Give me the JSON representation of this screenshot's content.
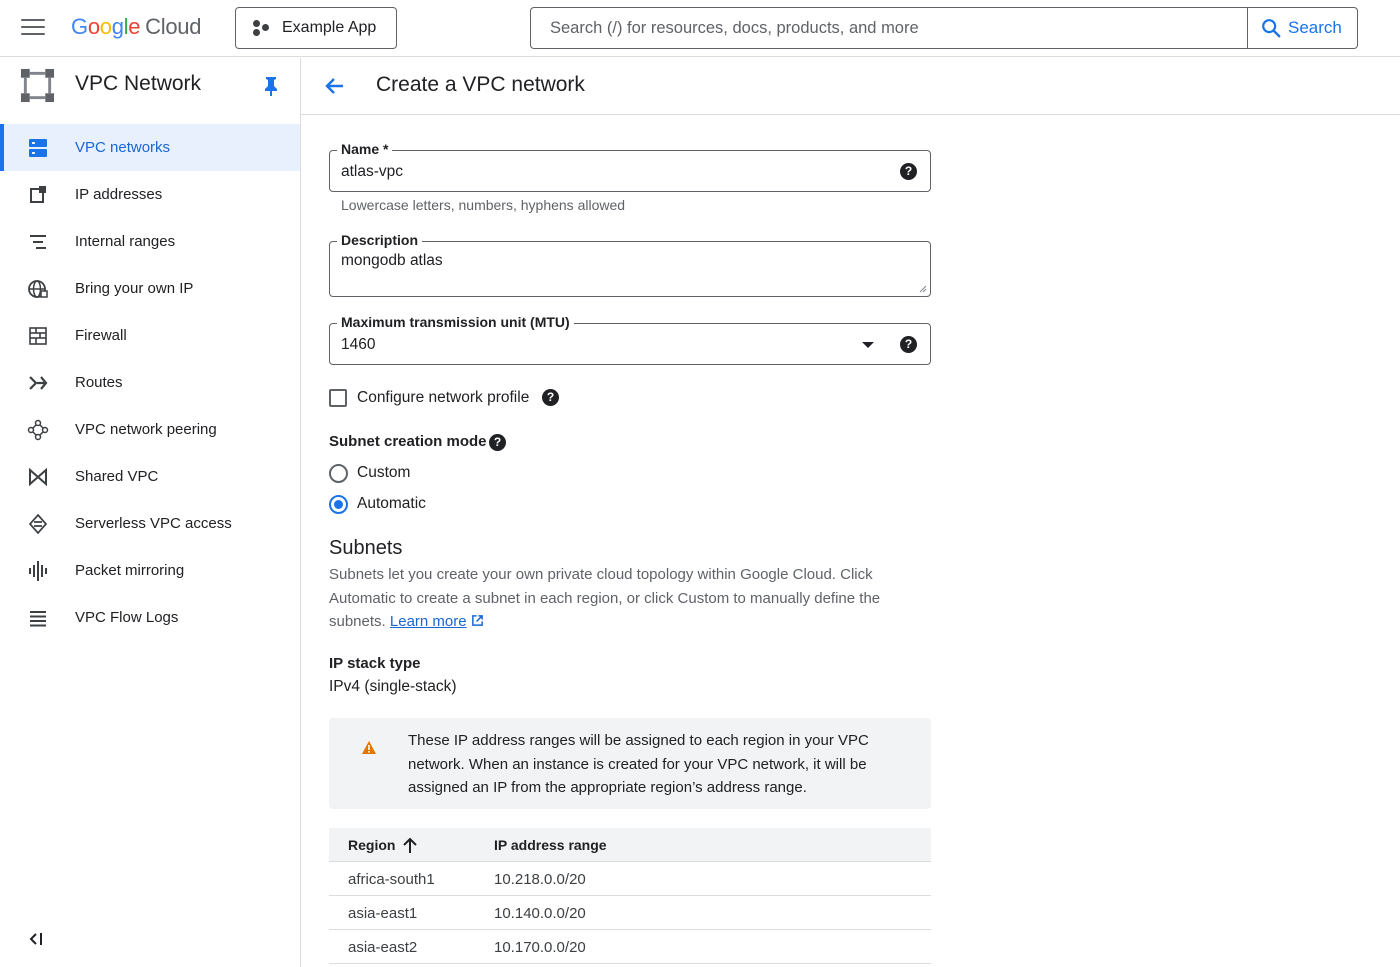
{
  "topbar": {
    "logo_letters": [
      "G",
      "o",
      "o",
      "g",
      "l",
      "e"
    ],
    "logo_product": "Cloud",
    "project_name": "Example App",
    "search_placeholder": "Search (/) for resources, docs, products, and more",
    "search_button": "Search"
  },
  "sidebar": {
    "title": "VPC Network",
    "items": [
      {
        "label": "VPC networks",
        "icon": "vpc-networks-icon",
        "active": true
      },
      {
        "label": "IP addresses",
        "icon": "ip-addresses-icon"
      },
      {
        "label": "Internal ranges",
        "icon": "internal-ranges-icon"
      },
      {
        "label": "Bring your own IP",
        "icon": "globe-icon"
      },
      {
        "label": "Firewall",
        "icon": "firewall-icon"
      },
      {
        "label": "Routes",
        "icon": "routes-icon"
      },
      {
        "label": "VPC network peering",
        "icon": "peering-icon"
      },
      {
        "label": "Shared VPC",
        "icon": "shared-vpc-icon"
      },
      {
        "label": "Serverless VPC access",
        "icon": "serverless-icon"
      },
      {
        "label": "Packet mirroring",
        "icon": "packet-mirroring-icon"
      },
      {
        "label": "VPC Flow Logs",
        "icon": "flow-logs-icon"
      }
    ]
  },
  "page": {
    "title": "Create a VPC network"
  },
  "form": {
    "name_label": "Name *",
    "name_value": "atlas-vpc",
    "name_hint": "Lowercase letters, numbers, hyphens allowed",
    "description_label": "Description",
    "description_value": "mongodb atlas",
    "mtu_label": "Maximum transmission unit (MTU)",
    "mtu_value": "1460",
    "network_profile_label": "Configure network profile",
    "subnet_mode_label": "Subnet creation mode",
    "subnet_mode_options": [
      "Custom",
      "Automatic"
    ],
    "subnet_mode_selected": "Automatic",
    "help_glyph": "?"
  },
  "subnets": {
    "title": "Subnets",
    "description": "Subnets let you create your own private cloud topology within Google Cloud. Click Automatic to create a subnet in each region, or click Custom to manually define the subnets.",
    "learn_more": "Learn more",
    "ip_stack_label": "IP stack type",
    "ip_stack_value": "IPv4 (single-stack)",
    "warning": "These IP address ranges will be assigned to each region in your VPC network. When an instance is created for your VPC network, it will be assigned an IP from the appropriate region’s address range.",
    "table": {
      "headers": [
        "Region",
        "IP address range"
      ],
      "rows": [
        [
          "africa-south1",
          "10.218.0.0/20"
        ],
        [
          "asia-east1",
          "10.140.0.0/20"
        ],
        [
          "asia-east2",
          "10.170.0.0/20"
        ]
      ]
    }
  },
  "colors": {
    "accent": "#1a73e8",
    "active_bg": "#e8f0fe",
    "warning": "#e37400"
  }
}
